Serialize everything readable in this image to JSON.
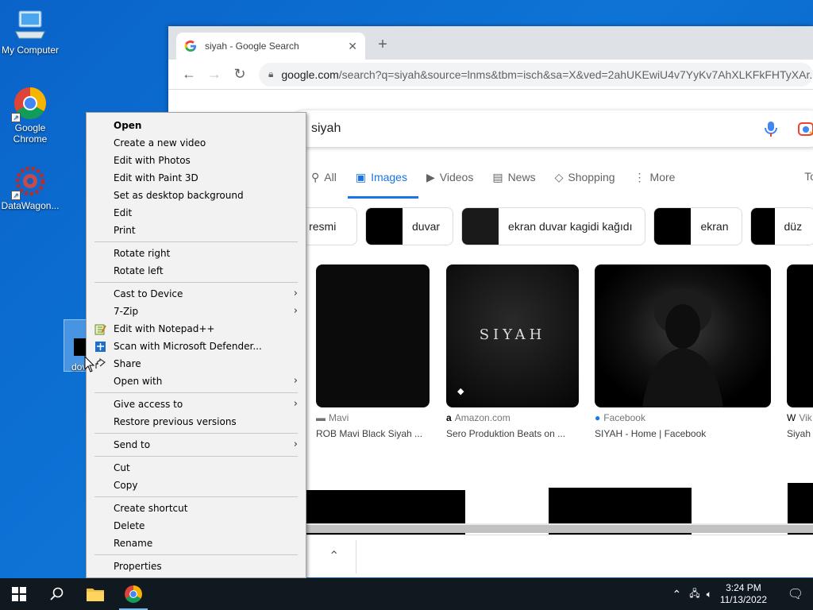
{
  "desktop": {
    "icons": [
      {
        "label": "My Computer"
      },
      {
        "label": "Google Chrome"
      },
      {
        "label": "DataWagon..."
      }
    ],
    "selected_file_label": "dov"
  },
  "browser": {
    "tab_title": "siyah - Google Search",
    "url_host": "google.com",
    "url_path": "/search?q=siyah&source=lnms&tbm=isch&sa=X&ved=2ahUKEwiU4v7YyKv7AhXLKFkFHTyXAr...",
    "search_query": "siyah",
    "tabs": [
      {
        "label": "All",
        "icon": "search-icon"
      },
      {
        "label": "Images",
        "icon": "image-icon"
      },
      {
        "label": "Videos",
        "icon": "video-icon"
      },
      {
        "label": "News",
        "icon": "news-icon"
      },
      {
        "label": "Shopping",
        "icon": "tag-icon"
      },
      {
        "label": "More",
        "icon": "more-vert-icon"
      }
    ],
    "tools_label": "To",
    "chips": [
      {
        "label": "il resmi"
      },
      {
        "label": "duvar"
      },
      {
        "label": "ekran duvar kagidi kağıdı"
      },
      {
        "label": "ekran"
      },
      {
        "label": "düz"
      }
    ],
    "results": [
      {
        "source": "Mavi",
        "title": "ROB Mavi Black Siyah ..."
      },
      {
        "source": "Amazon.com",
        "title": "Sero Produktion Beats on ...",
        "overlay": "SIYAH"
      },
      {
        "source": "Facebook",
        "title": "SIYAH - Home | Facebook"
      },
      {
        "source": "Vik",
        "title": "Siyah"
      }
    ],
    "accent": "#1a73e8"
  },
  "context_menu": {
    "groups": [
      [
        {
          "label": "Open",
          "bold": true
        },
        {
          "label": "Create a new video"
        },
        {
          "label": "Edit with Photos"
        },
        {
          "label": "Edit with Paint 3D"
        },
        {
          "label": "Set as desktop background"
        },
        {
          "label": "Edit"
        },
        {
          "label": "Print"
        }
      ],
      [
        {
          "label": "Rotate right"
        },
        {
          "label": "Rotate left"
        }
      ],
      [
        {
          "label": "Cast to Device",
          "submenu": true
        },
        {
          "label": "7-Zip",
          "submenu": true
        },
        {
          "label": "Edit with Notepad++",
          "icon": "notepadpp-icon"
        },
        {
          "label": "Scan with Microsoft Defender...",
          "icon": "defender-shield-icon"
        },
        {
          "label": "Share",
          "icon": "share-icon"
        },
        {
          "label": "Open with",
          "submenu": true
        }
      ],
      [
        {
          "label": "Give access to",
          "submenu": true
        },
        {
          "label": "Restore previous versions"
        }
      ],
      [
        {
          "label": "Send to",
          "submenu": true
        }
      ],
      [
        {
          "label": "Cut"
        },
        {
          "label": "Copy"
        }
      ],
      [
        {
          "label": "Create shortcut"
        },
        {
          "label": "Delete"
        },
        {
          "label": "Rename"
        }
      ],
      [
        {
          "label": "Properties"
        }
      ]
    ]
  },
  "taskbar": {
    "time": "3:24 PM",
    "date": "11/13/2022"
  }
}
